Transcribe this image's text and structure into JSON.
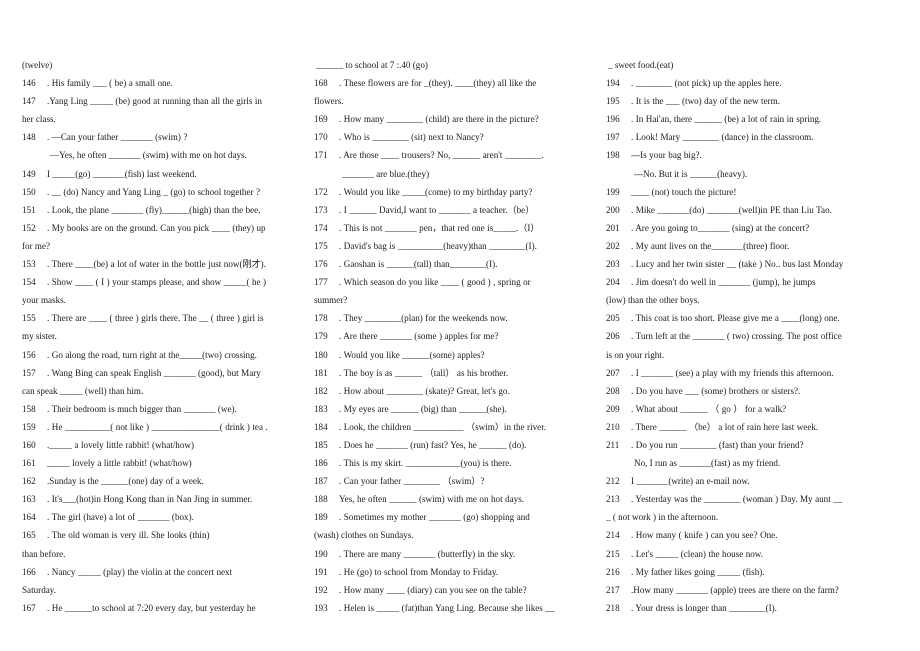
{
  "document": {
    "type": "english-grammar-worksheet",
    "layout": "three-column",
    "columns": [
      {
        "id": "column-1",
        "header_fragment": "(twelve)",
        "items": [
          {
            "num": "146",
            "text": ". His family ___ ( be) a small one.",
            "justify": false
          },
          {
            "num": "147",
            "text": ".Yang Ling _____ (be) good at running than all the girls in",
            "justify": true,
            "continuation": [
              "her class."
            ]
          },
          {
            "num": "148",
            "text": ". —Can your father _______ (swim) ?",
            "justify": false,
            "continuation_indent": [
              "—Yes, he often _______ (swim) with me on hot days."
            ]
          },
          {
            "num": "149",
            "text": "I _____(go) _______(fish) last weekend.",
            "justify": false
          },
          {
            "num": "150",
            "text": ". __ (do) Nancy and Yang Ling _ (go) to school together ?",
            "justify": false
          },
          {
            "num": "151",
            "text": ". Look, the plane _______ (fly)______(high) than the bee.",
            "justify": false
          },
          {
            "num": "152",
            "text": ". My books are on the ground. Can you pick ____ (they) up",
            "justify": true,
            "continuation": [
              "for me?"
            ]
          },
          {
            "num": "153",
            "text": ". There ____(be) a lot of water in the bottle just now(刚才).",
            "justify": false
          },
          {
            "num": "154",
            "text": ". Show ____ ( I ) your stamps please, and show _____( he )",
            "justify": true,
            "continuation": [
              "your masks."
            ]
          },
          {
            "num": "155",
            "text": ". There are ____ ( three ) girls there. The __ ( three ) girl is",
            "justify": true,
            "continuation": [
              "my sister."
            ]
          },
          {
            "num": "156",
            "text": ". Go along the road, turn right at the_____(two) crossing.",
            "justify": false
          },
          {
            "num": "157",
            "text": ". Wang Bing can speak English _______ (good), but Mary",
            "justify": true,
            "continuation": [
              "can speak _____ (well) than him."
            ]
          },
          {
            "num": "158",
            "text": ". Their bedroom is much bigger than _______ (we).",
            "justify": false
          },
          {
            "num": "159",
            "text": ". He __________( not like ) _______________( drink ) tea .",
            "justify": false
          },
          {
            "num": "160",
            "text": "._____ a lovely little rabbit! (what/how)",
            "justify": false
          },
          {
            "num": "161",
            "text": "_____ lovely    a    little rabbit! (what/how)",
            "justify": false
          },
          {
            "num": "162",
            "text": ".Sunday is the ______(one) day of a week.",
            "justify": false
          },
          {
            "num": "163",
            "text": ". It's___(hot)in Hong Kong than in Nan Jing in summer.",
            "justify": false
          },
          {
            "num": "164",
            "text": ". The girl              (have) a lot of   _______          (box).",
            "justify": false
          },
          {
            "num": "165",
            "text": ". The old woman is very ill. She looks                 (thin)",
            "justify": true,
            "continuation": [
              "than before."
            ]
          },
          {
            "num": "166",
            "text": ". Nancy _____ (play) the violin at the concert next",
            "justify": true,
            "continuation": [
              "Saturday."
            ]
          },
          {
            "num": "167",
            "text": ". He ______to school at 7:20 every day, but yesterday he",
            "justify": false
          }
        ]
      },
      {
        "id": "column-2",
        "header_fragment": "______ to school at 7 :.40 (go)",
        "items": [
          {
            "num": "168",
            "text": ". These flowers are for _(they). ____(they) all like the",
            "justify": true,
            "continuation": [
              "flowers."
            ]
          },
          {
            "num": "169",
            "text": ". How many ________        (child) are there in the picture?",
            "justify": false
          },
          {
            "num": "170",
            "text": ". Who is ________     (sit) next to Nancy?",
            "justify": false
          },
          {
            "num": "171",
            "text": ". Are those ____ trousers? No, ______ aren't ________.",
            "justify": true,
            "continuation_indent": [
              "_______ are blue.(they)"
            ]
          },
          {
            "num": "172",
            "text": ". Would you like _____(come) to my birthday party?",
            "justify": false
          },
          {
            "num": "173",
            "text": ". I ______  David,I want to _______ a   teacher.（be）",
            "justify": false
          },
          {
            "num": "174",
            "text": ". This is not _______ pen，that red one is_____.（I）",
            "justify": false
          },
          {
            "num": "175",
            "text": ". David's bag is __________(heavy)than ________(I).",
            "justify": false
          },
          {
            "num": "176",
            "text": ". Gaoshan is ______(tall) than________(I).",
            "justify": false
          },
          {
            "num": "177",
            "text": ". Which season do you like ____ ( good ) , spring or",
            "justify": true,
            "continuation": [
              "summer?"
            ]
          },
          {
            "num": "178",
            "text": ". They ________(plan) for the weekends now.",
            "justify": false
          },
          {
            "num": "179",
            "text": ". Are there     _______ (some ) apples for me?",
            "justify": false
          },
          {
            "num": "180",
            "text": ". Would you like ______(some) apples?",
            "justify": false
          },
          {
            "num": "181",
            "text": ". The boy is as ______ （tall） as his brother.",
            "justify": false
          },
          {
            "num": "182",
            "text": ". How about ________ (skate)?    Great, let's go.",
            "justify": false
          },
          {
            "num": "183",
            "text": ". My eyes are ______ (big) than ______(she).",
            "justify": false
          },
          {
            "num": "184",
            "text": ". Look, the children ___________ （swim）in the river.",
            "justify": false
          },
          {
            "num": "185",
            "text": ". Does he  _______ (run) fast? Yes, he ______ (do).",
            "justify": false
          },
          {
            "num": "186",
            "text": ". This is my skirt. ____________(you) is there.",
            "justify": false
          },
          {
            "num": "187",
            "text": ". Can your father ________ （swim）?",
            "justify": false
          },
          {
            "num": "188",
            "text": "Yes, he often ______ (swim) with me on hot days.",
            "justify": false
          },
          {
            "num": "189",
            "text": ". Sometimes my mother _______ (go) shopping and",
            "justify": true,
            "continuation": [
              "(wash) clothes on Sundays."
            ]
          },
          {
            "num": "190",
            "text": ". There are many _______ (butterfly) in the sky.",
            "justify": false
          },
          {
            "num": "191",
            "text": ". He        (go) to school from Monday to Friday.",
            "justify": false
          },
          {
            "num": "192",
            "text": ". How many ____ (diary) can you see on the table?",
            "justify": false
          },
          {
            "num": "193",
            "text": ". Helen is _____ (fat)than Yang Ling. Because she likes __",
            "justify": false
          }
        ]
      },
      {
        "id": "column-3",
        "header_fragment": "_ sweet food.(eat)",
        "items": [
          {
            "num": "194",
            "text": ". ________ (not pick) up the apples here.",
            "justify": false
          },
          {
            "num": "195",
            "text": ". It is the   ___ (two) day of the new term.",
            "justify": false
          },
          {
            "num": "196",
            "text": ". In Hai'an, there ______ (be) a lot of rain in spring.",
            "justify": false
          },
          {
            "num": "197",
            "text": ". Look! Mary ________ (dance) in the classroom.",
            "justify": false
          },
          {
            "num": "198",
            "text": "---Is your bag big?.",
            "justify": false,
            "continuation_indent": [
              "---No. But it is ______(heavy)."
            ]
          },
          {
            "num": "199",
            "text": "____ (not) touch the picture!",
            "justify": false
          },
          {
            "num": "200",
            "text": ". Mike _______(do) _______(well)in PE than Liu Tao.",
            "justify": false
          },
          {
            "num": "201",
            "text": ". Are you going to_______ (sing) at the concert?",
            "justify": false
          },
          {
            "num": "202",
            "text": ". My aunt lives on the_______(three) floor.",
            "justify": false
          },
          {
            "num": "203",
            "text": ". Lucy and her twin sister __ (take ) No.. bus last Monday",
            "justify": false
          },
          {
            "num": "204",
            "text": ". Jim doesn't do well in   _______ (jump), he jumps",
            "justify": true,
            "continuation": [
              "(low) than the other boys."
            ]
          },
          {
            "num": "205",
            "text": ". This coat is too short. Please give me a ____(long) one.",
            "justify": false
          },
          {
            "num": "206",
            "text": ". Turn left at the _______ ( two) crossing. The post office",
            "justify": true,
            "continuation": [
              "is on your right."
            ]
          },
          {
            "num": "207",
            "text": ". I _______ (see) a play with my friends this afternoon.",
            "justify": false
          },
          {
            "num": "208",
            "text": ". Do you have   ___ (some) brothers or sisters?.",
            "justify": false
          },
          {
            "num": "209",
            "text": ". What about ______ （ go ）  for a walk?",
            "justify": false
          },
          {
            "num": "210",
            "text": ". There ______ （be） a lot of rain here last week.",
            "justify": false
          },
          {
            "num": "211",
            "text": ". Do you run ________   (fast) than your friend?",
            "justify": false,
            "continuation_indent": [
              "No, I run as _______(fast) as my friend."
            ]
          },
          {
            "num": "212",
            "text": "I _______(write) an e-mail now.",
            "justify": false
          },
          {
            "num": "213",
            "text": ". Yesterday was the   ________ (woman ) Day. My aunt   __",
            "justify": true,
            "continuation": [
              "_ ( not work ) in the afternoon."
            ]
          },
          {
            "num": "214",
            "text": ". How many             ( knife ) can you see? One.",
            "justify": false
          },
          {
            "num": "215",
            "text": ". Let's _____   (clean) the house now.",
            "justify": false
          },
          {
            "num": "216",
            "text": ". My father likes going _____  (fish).",
            "justify": false
          },
          {
            "num": "217",
            "text": ".How many _______ (apple) trees are there on the farm?",
            "justify": false
          },
          {
            "num": "218",
            "text": ". Your dress is longer than ________(I).",
            "justify": false
          }
        ]
      }
    ]
  }
}
